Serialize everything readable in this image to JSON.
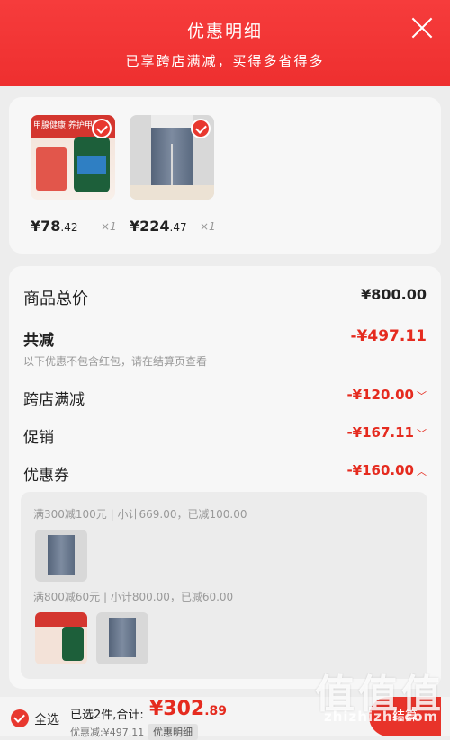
{
  "header": {
    "title": "优惠明细",
    "subtitle": "已享跨店满减，买得多省得多"
  },
  "products": [
    {
      "name_visual": "甲腺健康 养护甲腺",
      "price_int": "¥78",
      "price_dec": ".42",
      "qty": "×1",
      "selected": true
    },
    {
      "name_visual": "levi's jeans",
      "price_int": "¥224",
      "price_dec": ".47",
      "qty": "×1",
      "selected": true
    }
  ],
  "summary": {
    "total_label": "商品总价",
    "total_value": "¥800.00",
    "reduce_label": "共减",
    "reduce_value": "-¥497.11",
    "note": "以下优惠不包含红包，请在结算页查看",
    "items": [
      {
        "label": "跨店满减",
        "value": "-¥120.00",
        "chevron": "﹀"
      },
      {
        "label": "促销",
        "value": "-¥167.11",
        "chevron": "﹀"
      },
      {
        "label": "优惠券",
        "value": "-¥160.00",
        "chevron": "︿"
      }
    ]
  },
  "coupon": {
    "line1": "满300减100元 | 小计669.00，已减100.00",
    "line2": "满800减60元 | 小计800.00，已减60.00"
  },
  "bottom": {
    "select_all": "全选",
    "selected_info": "已选2件,合计:",
    "total_int": "¥302",
    "total_dec": ".89",
    "discount": "优惠减:¥497.11",
    "detail_button": "优惠明细",
    "checkout": "结算"
  },
  "watermark": {
    "big": "值值值",
    "small": "zhizhizhi.com"
  },
  "colors": {
    "accent": "#e8332a",
    "header": "#f63c3c"
  }
}
